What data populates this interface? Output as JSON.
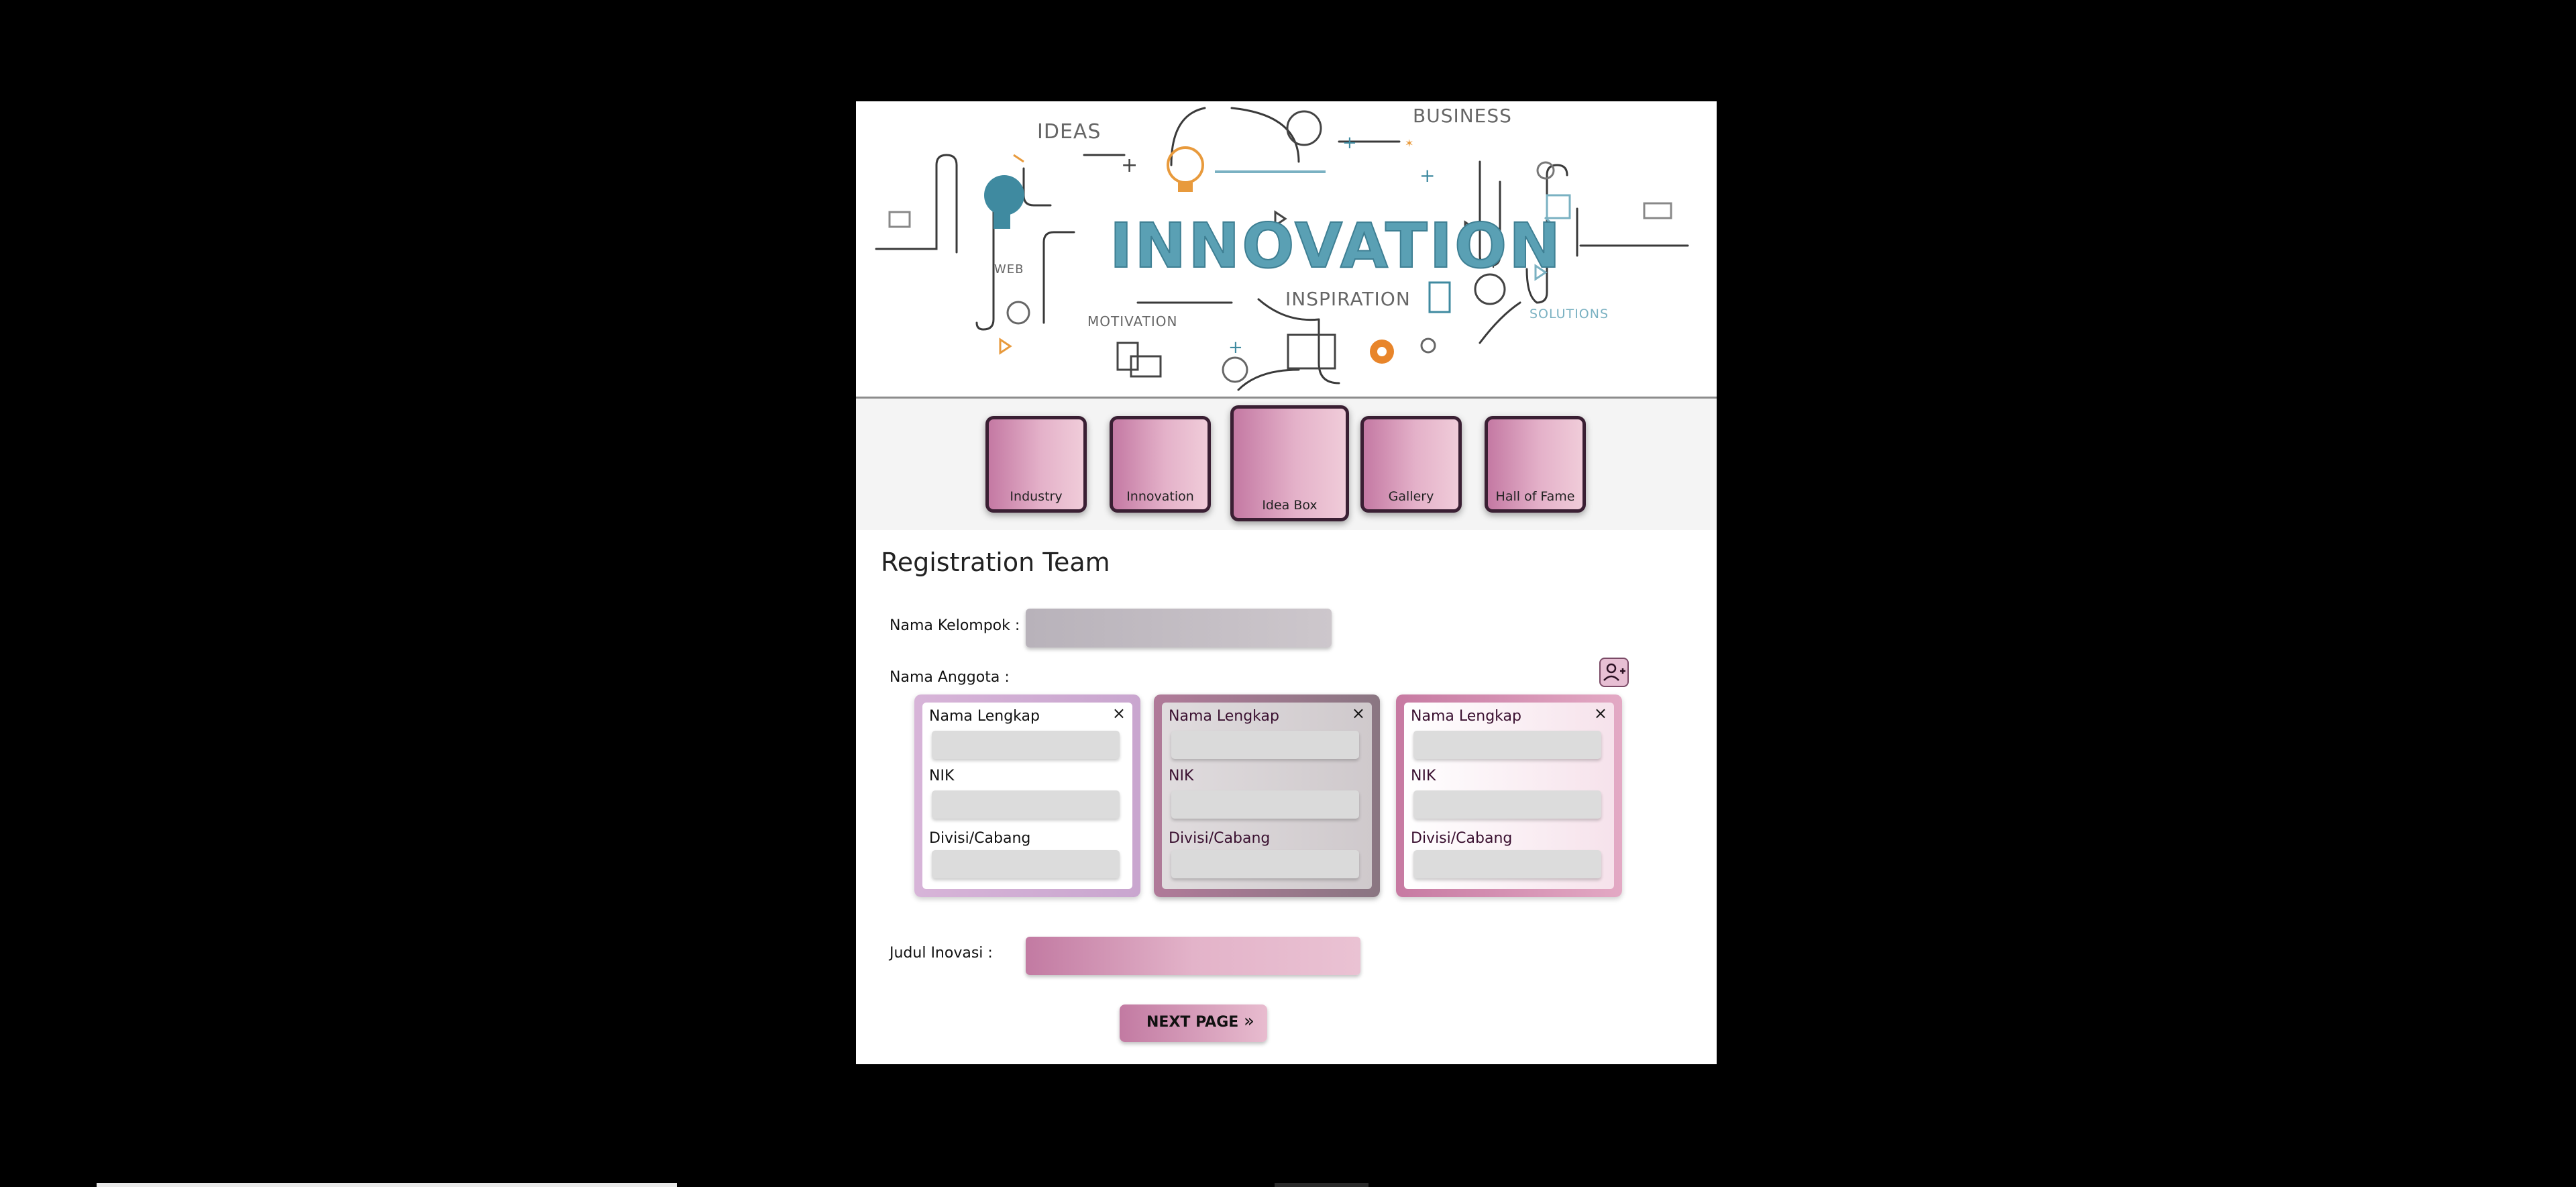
{
  "banner": {
    "title": "INNOVATION",
    "words": [
      "IDEAS",
      "BUSINESS",
      "WEB",
      "MOTIVATION",
      "INSPIRATION",
      "SOLUTIONS"
    ]
  },
  "nav": {
    "items": [
      {
        "label": "Industry"
      },
      {
        "label": "Innovation"
      },
      {
        "label": "Idea Box"
      },
      {
        "label": "Gallery"
      },
      {
        "label": "Hall of Fame"
      }
    ]
  },
  "form": {
    "title": "Registration Team",
    "nama_kelompok_label": "Nama Kelompok :",
    "nama_kelompok_value": "",
    "nama_anggota_label": "Nama Anggota :",
    "members": [
      {
        "nama_lengkap_label": "Nama Lengkap",
        "nik_label": "NIK",
        "divisi_label": "Divisi/Cabang",
        "close": "×"
      },
      {
        "nama_lengkap_label": "Nama Lengkap",
        "nik_label": "NIK",
        "divisi_label": "Divisi/Cabang",
        "close": "×"
      },
      {
        "nama_lengkap_label": "Nama Lengkap",
        "nik_label": "NIK",
        "divisi_label": "Divisi/Cabang",
        "close": "×"
      }
    ],
    "judul_label": "Judul Inovasi :",
    "judul_value": "",
    "next_label": "NEXT PAGE",
    "next_icon": "»"
  },
  "icons": {
    "add_member": "add-user-icon"
  },
  "colors": {
    "accent_pink": "#c479a3",
    "banner_title": "#5aa0b4",
    "tile_border": "#3a1f33"
  }
}
